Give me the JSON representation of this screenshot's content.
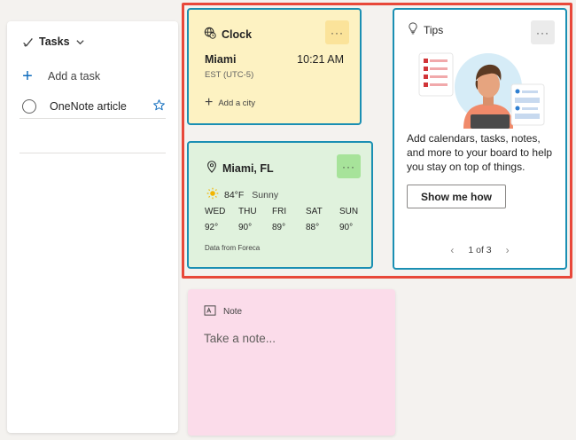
{
  "tasks": {
    "title": "Tasks",
    "add_placeholder": "Add a task",
    "items": [
      {
        "name": "OneNote article",
        "starred": true
      }
    ]
  },
  "clock": {
    "title": "Clock",
    "more": "···",
    "city": "Miami",
    "time": "10:21 AM",
    "timezone": "EST (UTC-5)",
    "add_city": "Add a city"
  },
  "weather": {
    "title": "Miami, FL",
    "more": "···",
    "current_temp": "84°F",
    "current_condition": "Sunny",
    "forecast": [
      {
        "day": "WED",
        "temp": "92°"
      },
      {
        "day": "THU",
        "temp": "90°"
      },
      {
        "day": "FRI",
        "temp": "89°"
      },
      {
        "day": "SAT",
        "temp": "88°"
      },
      {
        "day": "SUN",
        "temp": "90°"
      }
    ],
    "source": "Data from Foreca"
  },
  "tips": {
    "title": "Tips",
    "more": "···",
    "body": "Add calendars, tasks, notes, and more to your board to help you stay on top of things.",
    "button": "Show me how",
    "pager": "1 of 3",
    "prev": "‹",
    "next": "›"
  },
  "note": {
    "title": "Note",
    "placeholder": "Take a note..."
  },
  "colors": {
    "highlight": "#e8483a",
    "card_border": "#1a8fb3",
    "clock_bg": "#fdf2c2",
    "weather_bg": "#e0f2dd",
    "note_bg": "#fbdcea",
    "accent": "#0f6cbd"
  }
}
